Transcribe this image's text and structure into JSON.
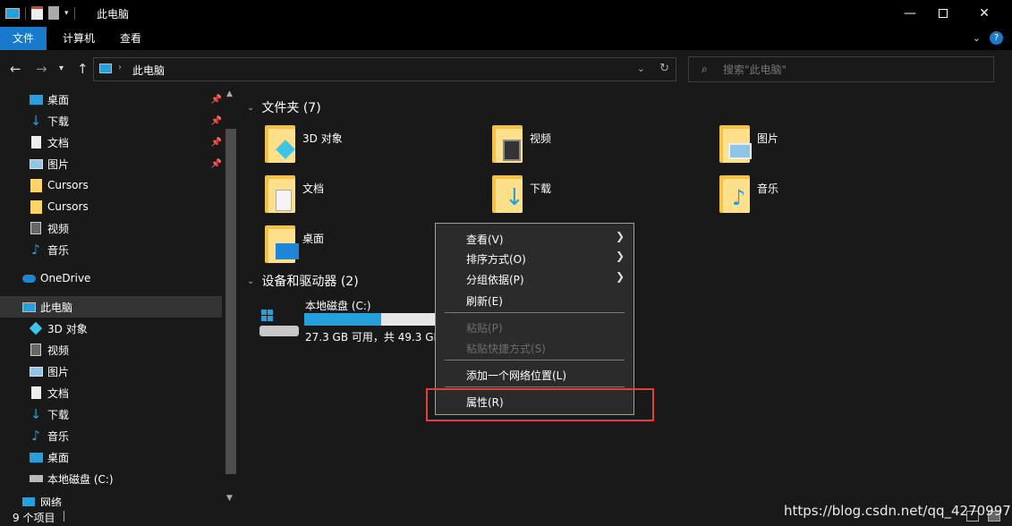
{
  "window": {
    "title": "此电脑",
    "minimize_icon": "minimize-icon",
    "maximize_icon": "maximize-icon",
    "close_icon": "close-icon"
  },
  "ribbon": {
    "tabs": [
      {
        "label": "文件",
        "active": true
      },
      {
        "label": "计算机"
      },
      {
        "label": "查看"
      }
    ]
  },
  "navigation": {
    "address_text": "此电脑",
    "search_placeholder": "搜索\"此电脑\""
  },
  "sidebar": {
    "quick_access": [
      {
        "label": "桌面",
        "pinned": true
      },
      {
        "label": "下载",
        "pinned": true
      },
      {
        "label": "文档",
        "pinned": true
      },
      {
        "label": "图片",
        "pinned": true
      },
      {
        "label": "Cursors"
      },
      {
        "label": "Cursors"
      },
      {
        "label": "视频"
      },
      {
        "label": "音乐"
      }
    ],
    "onedrive": "OneDrive",
    "this_pc": "此电脑",
    "this_pc_items": [
      {
        "label": "3D 对象"
      },
      {
        "label": "视频"
      },
      {
        "label": "图片"
      },
      {
        "label": "文档"
      },
      {
        "label": "下载"
      },
      {
        "label": "音乐"
      },
      {
        "label": "桌面"
      },
      {
        "label": "本地磁盘 (C:)"
      }
    ],
    "partial_last": "网络"
  },
  "main": {
    "folders_header": "文件夹 (7)",
    "folders": [
      {
        "label": "3D 对象"
      },
      {
        "label": "视频"
      },
      {
        "label": "图片"
      },
      {
        "label": "文档"
      },
      {
        "label": "下载"
      },
      {
        "label": "音乐"
      },
      {
        "label": "桌面"
      }
    ],
    "devices_header": "设备和驱动器 (2)",
    "drive": {
      "name": "本地磁盘 (C:)",
      "space": "27.3 GB 可用，共 49.3 GB",
      "used_fraction": 0.57
    }
  },
  "context_menu": {
    "items": [
      {
        "label": "查看(V)",
        "submenu": true
      },
      {
        "label": "排序方式(O)",
        "submenu": true
      },
      {
        "label": "分组依据(P)",
        "submenu": true
      },
      {
        "label": "刷新(E)"
      },
      {
        "label": "粘贴(P)",
        "disabled": true
      },
      {
        "label": "粘贴快捷方式(S)",
        "disabled": true
      },
      {
        "label": "添加一个网络位置(L)"
      },
      {
        "label": "属性(R)"
      }
    ]
  },
  "status": {
    "count": "9 个项目"
  },
  "watermark": "https://blog.csdn.net/qq_42709977"
}
